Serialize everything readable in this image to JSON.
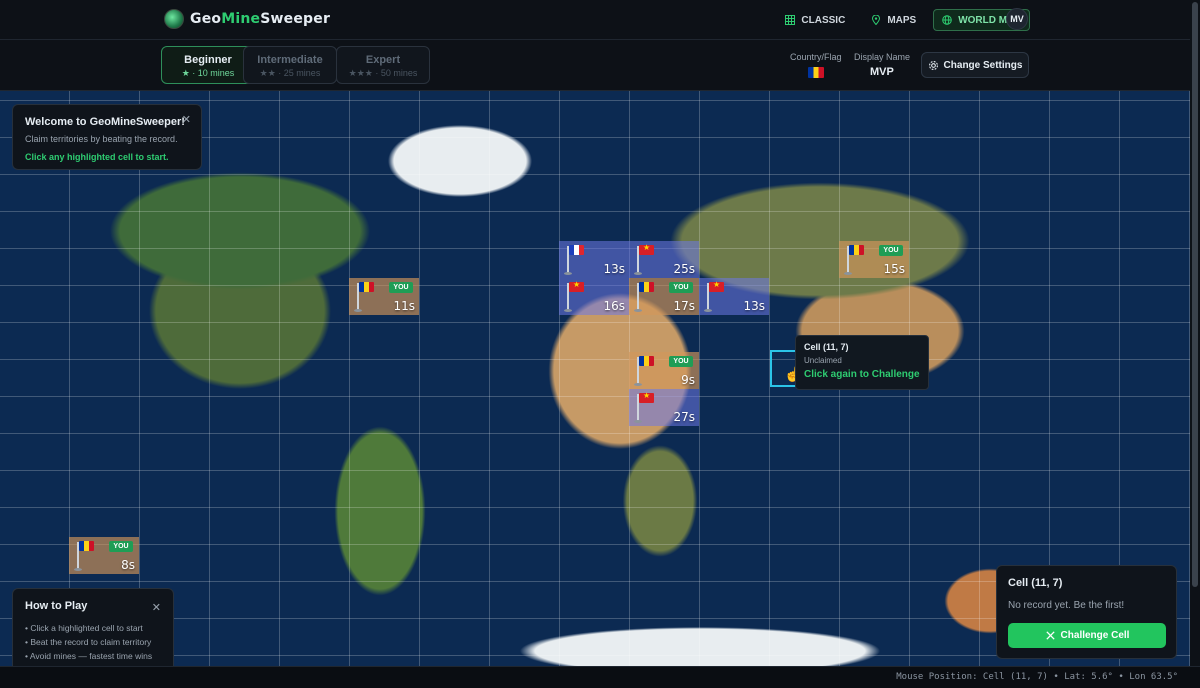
{
  "brand": {
    "part1": "Geo",
    "part2": "Mine",
    "part3": "Sweeper"
  },
  "nav": [
    {
      "label": "CLASSIC",
      "icon": "grid-icon"
    },
    {
      "label": "MAPS",
      "icon": "pin-icon"
    },
    {
      "label": "WORLD MAP",
      "icon": "globe-icon",
      "active": true
    }
  ],
  "avatar": "MV",
  "difficulties": [
    {
      "name": "Beginner",
      "stars": "★",
      "detail": "10 mines",
      "active": true
    },
    {
      "name": "Intermediate",
      "stars": "★★",
      "detail": "25 mines"
    },
    {
      "name": "Expert",
      "stars": "★★★",
      "detail": "50 mines"
    }
  ],
  "settings": {
    "country_label": "Country/Flag",
    "name_label": "Display Name",
    "name_value": "MVP",
    "change_button": "Change Settings"
  },
  "welcome": {
    "title": "Welcome to GeoMineSweeper!",
    "body": "Claim territories by beating the record.",
    "cta": "Click any highlighted cell to start."
  },
  "cells": [
    {
      "flag": "fr",
      "you": false,
      "time": "13s"
    },
    {
      "flag": "vn",
      "you": false,
      "time": "25s"
    },
    {
      "flag": "ro",
      "you": true,
      "time": "15s"
    },
    {
      "flag": "ro",
      "you": true,
      "time": "11s"
    },
    {
      "flag": "vn",
      "you": false,
      "time": "16s"
    },
    {
      "flag": "ro",
      "you": true,
      "time": "17s"
    },
    {
      "flag": "vn",
      "you": false,
      "time": "13s"
    },
    {
      "flag": "ro",
      "you": true,
      "time": "9s"
    },
    {
      "flag": "vn",
      "you": false,
      "time": "27s"
    },
    {
      "flag": "ro",
      "you": true,
      "time": "8s"
    }
  ],
  "you_badge": "YOU",
  "tooltip": {
    "title": "Cell (11, 7)",
    "status": "Unclaimed",
    "cta": "Click again to Challenge"
  },
  "how_to": {
    "title": "How to Play",
    "steps": [
      "Click a highlighted cell to start",
      "Beat the record to claim territory",
      "Avoid mines — fastest time wins"
    ]
  },
  "cell_panel": {
    "title": "Cell (11, 7)",
    "message": "No record yet. Be the first!",
    "button": "Challenge Cell"
  },
  "status_bar": "Mouse Position: Cell (11, 7) • Lat: 5.6° • Lon 63.5°",
  "colors": {
    "accent": "#2ecc71",
    "claimed_other": "#6e78e6",
    "claimed_you": "#d2965a",
    "hover": "#2bc4e8"
  }
}
